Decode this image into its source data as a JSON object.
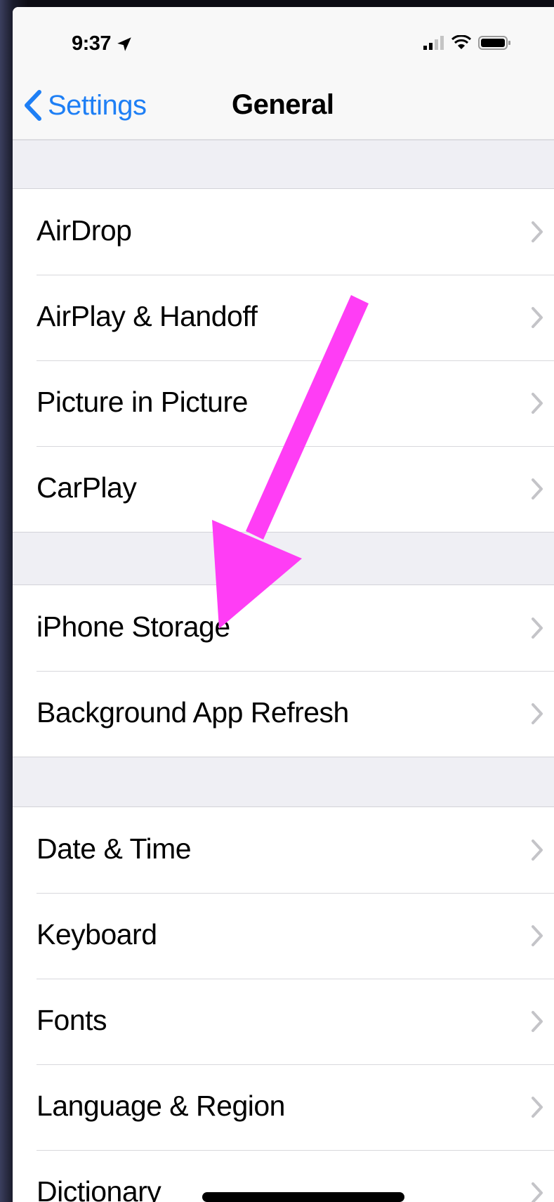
{
  "status_bar": {
    "time": "9:37",
    "location_icon": "location-arrow-icon",
    "signal_icon": "cellular-signal-icon",
    "wifi_icon": "wifi-icon",
    "battery_icon": "battery-icon"
  },
  "nav": {
    "back_label": "Settings",
    "title": "General",
    "back_icon": "chevron-left-icon"
  },
  "groups": [
    {
      "items": [
        "AirDrop",
        "AirPlay & Handoff",
        "Picture in Picture",
        "CarPlay"
      ]
    },
    {
      "items": [
        "iPhone Storage",
        "Background App Refresh"
      ]
    },
    {
      "items": [
        "Date & Time",
        "Keyboard",
        "Fonts",
        "Language & Region",
        "Dictionary"
      ]
    }
  ],
  "colors": {
    "accent": "#1e7ff5",
    "annotation_arrow": "#ff3df5",
    "background": "#efeff4",
    "cell": "#ffffff"
  },
  "annotation": {
    "icon": "arrow-annotation-icon",
    "points_to": "iPhone Storage"
  }
}
